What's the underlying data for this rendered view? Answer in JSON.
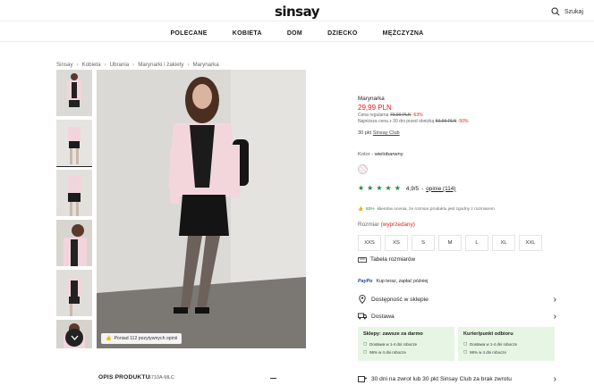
{
  "header": {
    "logo": "sinsay",
    "search_label": "Szukaj",
    "nav": [
      "POLECANE",
      "KOBIETA",
      "DOM",
      "DZIECKO",
      "MĘŻCZYZNA"
    ]
  },
  "breadcrumbs": [
    "Sinsay",
    "Kobieta",
    "Ubrania",
    "Marynarki i żakiety",
    "Marynarka"
  ],
  "gallery": {
    "review_badge": "Poniad 112 pozytywnych opinii"
  },
  "product": {
    "name": "Marynarka",
    "price": "29,99 PLN",
    "regular_label": "Cena regularna",
    "regular_price": "79,99 PLN",
    "regular_discount": "-63%",
    "lowest_label": "Najniższa cena z 30 dni przed obniżką",
    "lowest_price": "59,99 PLN",
    "lowest_discount": "-50%",
    "club_prefix": "30 pkt",
    "club_link": "Sinsay Club",
    "color_label": "Kolor -",
    "color_value": "wielobarwny",
    "rating_value": "4,9/5",
    "rating_sep": "-",
    "reviews_link": "opinie (114)",
    "stars": 5,
    "fit_percent": "83%",
    "fit_text": "klientów ocenia, że rozmiar produktu jest zgodny z rozmiarem",
    "size_label": "Rozmiar",
    "size_status": "(wyprzedany)",
    "sizes": [
      "XXS",
      "XS",
      "S",
      "M",
      "L",
      "XL",
      "XXL"
    ],
    "size_chart": "Tabela rozmiarów",
    "paypo_logo": "PayPo",
    "paypo_text": "Kup teraz, zapłać później",
    "store_availability": "Dostępność w sklepie",
    "delivery": "Dostawa",
    "delivery_boxes": [
      {
        "title": "Sklepy: zawsze za darmo",
        "lines": [
          "Dostawa w 1-4 dni robocze",
          "96% w 4 dni robocze"
        ]
      },
      {
        "title": "Kurier/punkt odbioru",
        "lines": [
          "Dostawa w 1-4 dni robocze",
          "96% w 4 dni robocze"
        ]
      }
    ],
    "returns": "30 dni na zwrot lub 30 pkt Sinsay Club za brak zwrotu"
  },
  "description": {
    "title": "OPIS PRODUKTU",
    "sku": "5710A-MLC"
  },
  "colors": {
    "accent_red": "#e31d1a",
    "rating_green": "#1f8a3d",
    "delivery_bg": "#e6f5e4"
  }
}
